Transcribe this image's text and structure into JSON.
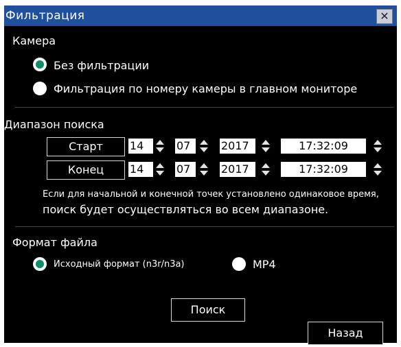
{
  "window": {
    "title": "Фильтрация",
    "close_glyph": "✕"
  },
  "camera": {
    "label": "Камера",
    "options": [
      {
        "label": "Без фильтрации",
        "selected": true
      },
      {
        "label": "Фильтрация по номеру камеры в главном мониторе",
        "selected": false
      }
    ]
  },
  "range": {
    "label": "Диапазон поиска",
    "start": {
      "button": "Старт",
      "day": "14",
      "month": "07",
      "year": "2017",
      "time": "17:32:09"
    },
    "end": {
      "button": "Конец",
      "day": "14",
      "month": "07",
      "year": "2017",
      "time": "17:32:09"
    },
    "note_line1": "Если для начальной и конечной точек установлено одинаковое время,",
    "note_line2": "поиск будет осуществляться во всем диапазоне."
  },
  "format": {
    "label": "Формат файла",
    "options": [
      {
        "label": "Исходный формат (n3r/n3a)",
        "selected": true
      },
      {
        "label": "MP4",
        "selected": false
      }
    ]
  },
  "buttons": {
    "search": "Поиск",
    "back": "Назад"
  },
  "colors": {
    "titlebar": "#1f4f9d",
    "radio_selected": "#0e8c69",
    "background": "#000000"
  }
}
